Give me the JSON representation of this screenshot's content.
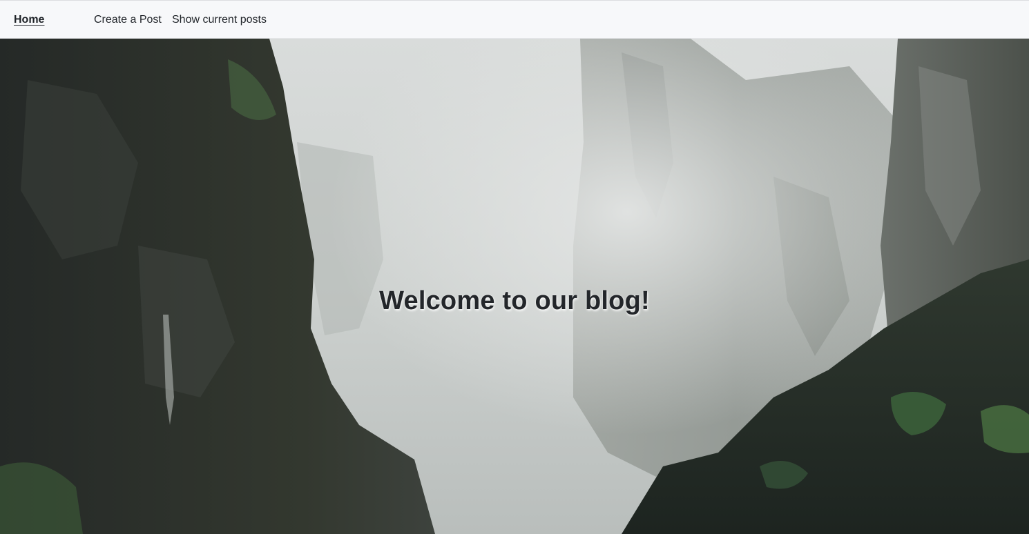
{
  "navbar": {
    "brand_label": "Home",
    "links": [
      {
        "label": "Create a Post"
      },
      {
        "label": "Show current posts"
      }
    ]
  },
  "hero": {
    "title": "Welcome to our blog!",
    "background": "misty-canyon-cliffs-photo"
  },
  "colors": {
    "navbar_bg": "#f7f8fa",
    "text": "#1f2328",
    "fog": "#cfd3d1",
    "cliff_dark": "#2b2f2c",
    "foliage": "#3d5a3a"
  }
}
